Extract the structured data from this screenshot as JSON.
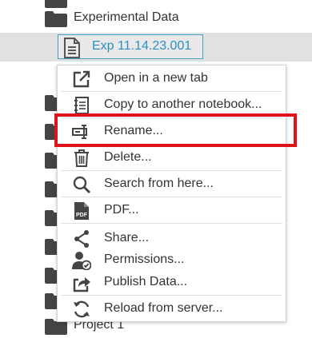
{
  "tree": {
    "folders": [
      {
        "label": ""
      },
      {
        "label": "Experimental Data"
      },
      {
        "label": ""
      },
      {
        "label": ""
      },
      {
        "label": ""
      },
      {
        "label": ""
      },
      {
        "label": ""
      },
      {
        "label": ""
      },
      {
        "label": ""
      },
      {
        "label": ""
      },
      {
        "label": "Project 1"
      }
    ],
    "selected_item": {
      "label": "Exp 11.14.23.001",
      "icon": "document-icon"
    }
  },
  "context_menu": {
    "items": [
      {
        "label": "Open in a new tab",
        "icon": "external-link-icon"
      },
      {
        "label": "Copy to another notebook...",
        "icon": "copy-notebook-icon"
      },
      {
        "label": "Rename...",
        "icon": "rename-icon"
      },
      {
        "label": "Delete...",
        "icon": "trash-icon"
      },
      {
        "label": "Search from here...",
        "icon": "search-icon"
      },
      {
        "label": "PDF...",
        "icon": "pdf-icon"
      },
      {
        "label": "Share...",
        "icon": "share-icon"
      },
      {
        "label": "Permissions...",
        "icon": "permissions-icon"
      },
      {
        "label": "Publish Data...",
        "icon": "publish-icon"
      },
      {
        "label": "Reload from server...",
        "icon": "reload-icon"
      }
    ],
    "highlighted_item": "Rename..."
  },
  "colors": {
    "accent": "#2c8fbf",
    "highlight_border": "#e0131a",
    "selection_background": "#e1e1e1",
    "folder": "#444444"
  }
}
